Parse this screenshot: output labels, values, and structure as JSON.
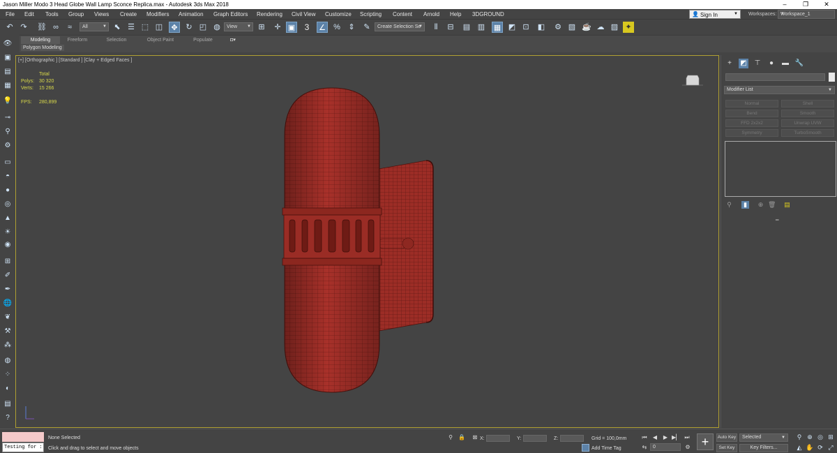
{
  "window": {
    "title": "Jason Miller Modo 3 Head Globe Wall Lamp Sconce Replica.max - Autodesk 3ds Max 2018",
    "minimize": "–",
    "maximize": "❐",
    "close": "✕"
  },
  "menu": {
    "items": [
      "File",
      "Edit",
      "Tools",
      "Group",
      "Views",
      "Create",
      "Modifiers",
      "Animation",
      "Graph Editors",
      "Rendering",
      "Civil View",
      "Customize",
      "Scripting",
      "Content",
      "Arnold",
      "Help",
      "3DGROUND"
    ],
    "sign_in": "Sign In",
    "workspaces_label": "Workspaces:",
    "workspace_value": "Workspace_1"
  },
  "toolbar": {
    "filter_value": "All",
    "ref_coord_value": "View",
    "selection_set_value": "Create Selection Se",
    "snap_value": "3"
  },
  "ribbon": {
    "tabs": [
      "Modeling",
      "Freeform",
      "Selection",
      "Object Paint",
      "Populate"
    ],
    "sub_label": "Polygon Modeling"
  },
  "viewport": {
    "label": "[+] [Orthographic ] [Standard ] [Clay + Edged Faces ]",
    "stats": {
      "total_label": "Total",
      "polys_label": "Polys:",
      "polys_value": "30 320",
      "verts_label": "Verts:",
      "verts_value": "15 266",
      "fps_label": "FPS:",
      "fps_value": "280,899"
    }
  },
  "command_panel": {
    "modifier_list": "Modifier List",
    "buttons": [
      "Normal",
      "Shell",
      "Bend",
      "Smooth",
      "FFD 2x2x2",
      "Unwrap UVW",
      "Symmetry",
      "TurboSmooth"
    ]
  },
  "status": {
    "selection": "None Selected",
    "prompt": "Click and drag to select and move objects",
    "listener_text": "Testing for :",
    "x_label": "X:",
    "y_label": "Y:",
    "z_label": "Z:",
    "grid": "Grid = 100,0mm",
    "add_time_tag": "Add Time Tag",
    "auto_key": "Auto Key",
    "set_key": "Set Key",
    "selected_value": "Selected",
    "key_filters": "Key Filters...",
    "frame_value": "0"
  },
  "colors": {
    "model_fill": "#a8312a",
    "model_wire": "#5a1510",
    "viewport_border": "#b0a032",
    "stats_text": "#d8d84a",
    "accent_blue": "#5c82a8"
  }
}
